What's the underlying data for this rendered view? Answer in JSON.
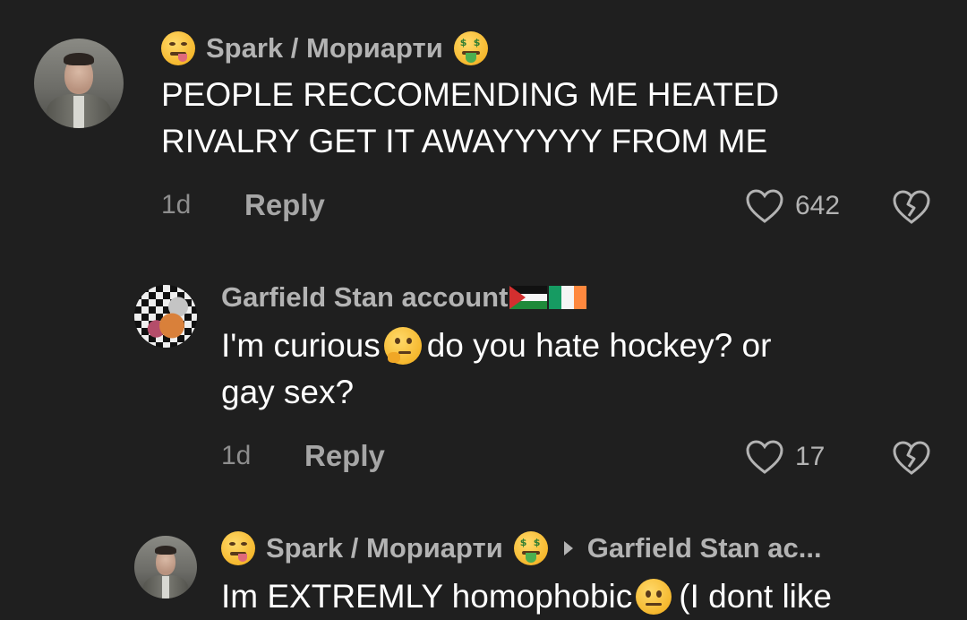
{
  "comments": [
    {
      "username": "Spark / Мориарти",
      "body_lines": [
        "PEOPLE RECCOMENDING ME HEATED",
        "RIVALRY GET IT AWAYYYYY FROM ME"
      ],
      "time": "1d",
      "reply_label": "Reply",
      "likes": "642"
    },
    {
      "username": "Garfield Stan account",
      "body_part1": "I'm curious",
      "body_part2": " do you hate hockey? or",
      "body_line2": "gay sex?",
      "time": "1d",
      "reply_label": "Reply",
      "likes": "17"
    },
    {
      "username": "Spark / Мориарти",
      "reply_to": "Garfield Stan ac...",
      "body_part1": "Im EXTREMLY homophobic ",
      "body_part2": " (I dont like"
    }
  ],
  "icons": {
    "like": "heart-outline-icon",
    "dislike": "broken-heart-icon",
    "yum_emoji": "face-savoring-food-emoji",
    "money_emoji": "money-mouth-face-emoji",
    "thinking_emoji": "thinking-face-emoji",
    "neutral_emoji": "neutral-face-emoji",
    "flags": [
      "palestine-flag",
      "ireland-flag"
    ]
  },
  "colors": {
    "background": "#1f1f1f",
    "username": "#b3b3b3",
    "body": "#ffffff",
    "meta": "#8e8e8e"
  }
}
